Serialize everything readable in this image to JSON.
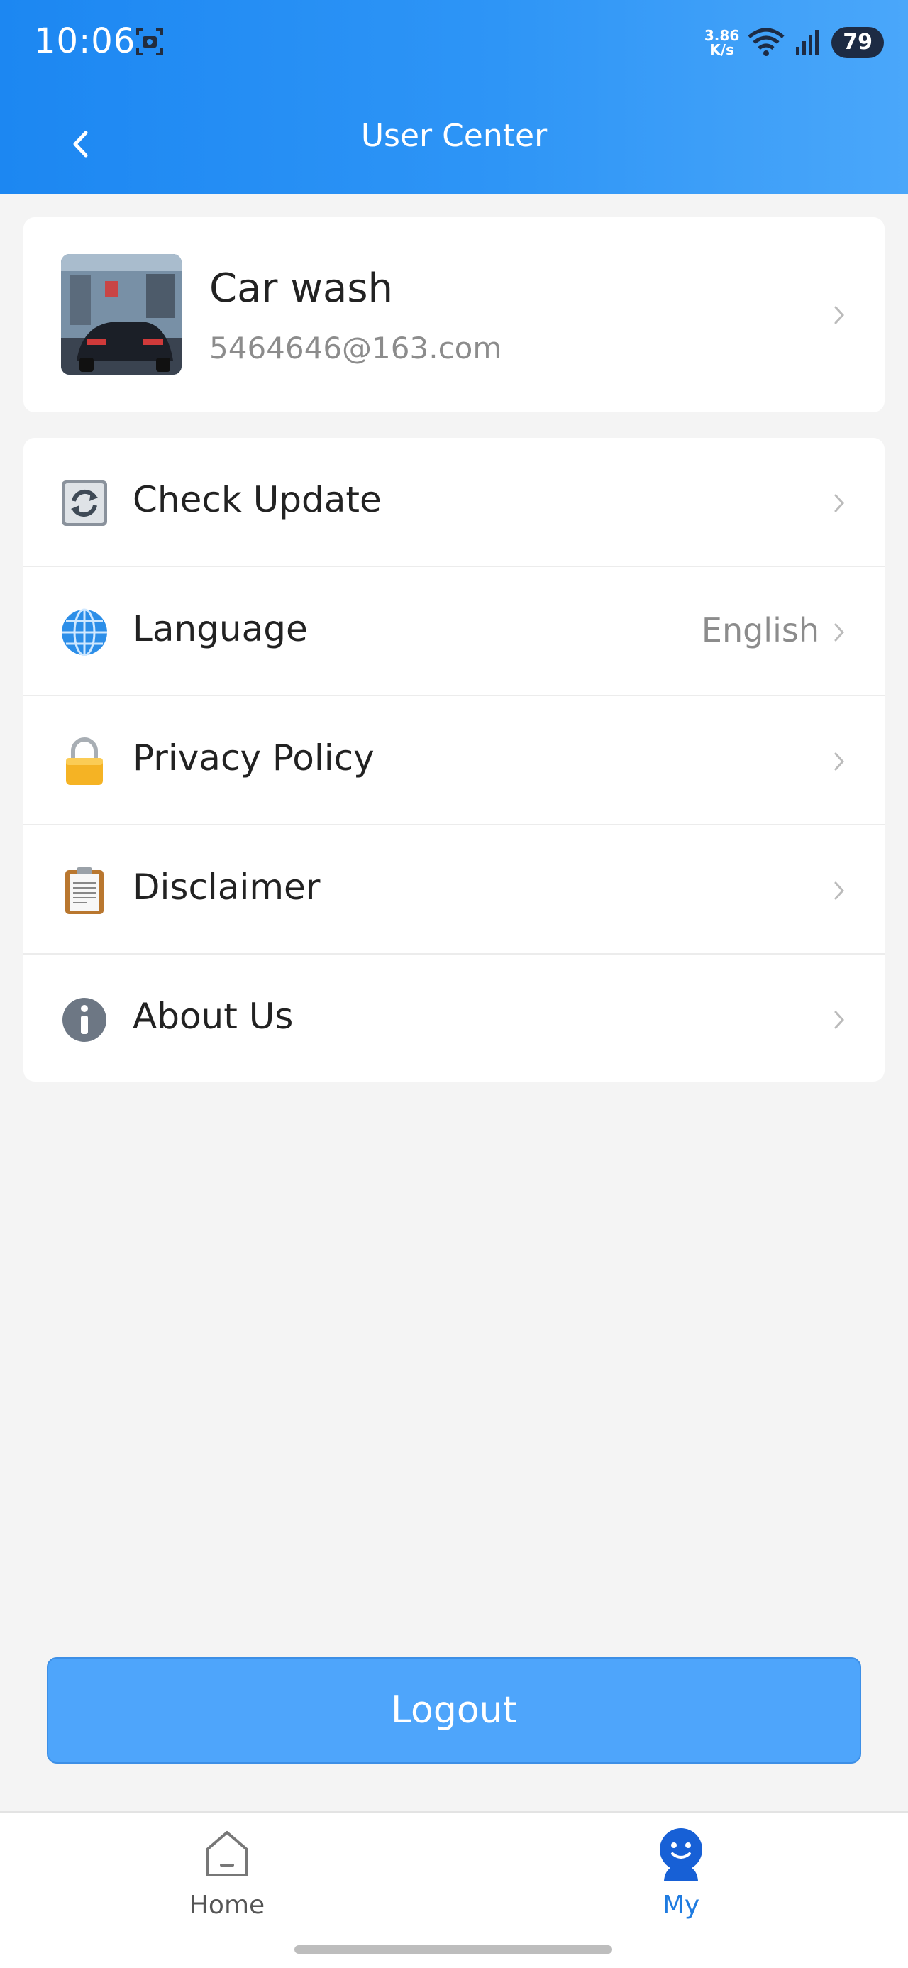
{
  "status_bar": {
    "time": "10:06",
    "net_speed_value": "3.86",
    "net_speed_unit": "K/s",
    "battery": "79"
  },
  "header": {
    "title": "User Center"
  },
  "profile": {
    "name": "Car wash",
    "email": "5464646@163.com"
  },
  "menu": {
    "items": [
      {
        "label": "Check Update",
        "value": "",
        "icon": "refresh-icon"
      },
      {
        "label": "Language",
        "value": "English",
        "icon": "globe-icon"
      },
      {
        "label": "Privacy Policy",
        "value": "",
        "icon": "lock-icon"
      },
      {
        "label": "Disclaimer",
        "value": "",
        "icon": "clipboard-icon"
      },
      {
        "label": "About Us",
        "value": "",
        "icon": "info-icon"
      }
    ]
  },
  "logout": {
    "label": "Logout"
  },
  "bottom_nav": {
    "items": [
      {
        "label": "Home",
        "icon": "home-icon",
        "active": false
      },
      {
        "label": "My",
        "icon": "my-icon",
        "active": true
      }
    ]
  },
  "colors": {
    "header_start": "#1c87f2",
    "header_end": "#4aa7fa",
    "logout": "#4ea5fb",
    "active_nav": "#1f7be0",
    "background": "#f4f4f4"
  }
}
